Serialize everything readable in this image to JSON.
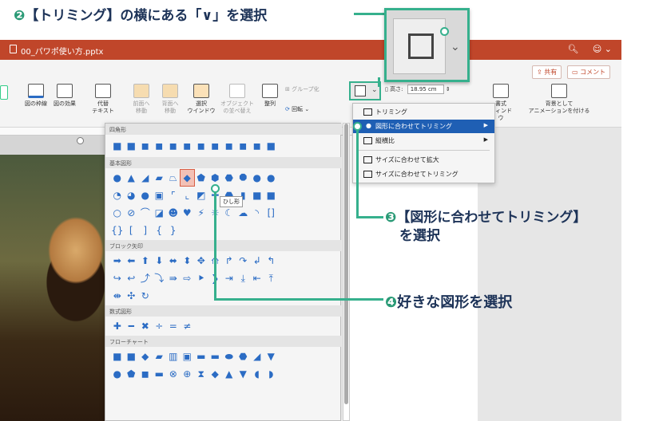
{
  "annotations": {
    "step2_num": "❷",
    "step2_text": "【トリミング】の横にある「∨」を選択",
    "step3_num": "❸",
    "step3_text_line1": "【図形に合わせてトリミング】",
    "step3_text_line2": "を選択",
    "step4_num": "❹",
    "step4_text": "好きな図形を選択"
  },
  "window": {
    "file_name": "00_パワポ使い方.pptx",
    "search_icon": "search-icon",
    "account_icon": "smiley-icon"
  },
  "ribbon": {
    "share_label": "共有",
    "comment_label": "コメント",
    "frame_label": "図の枠線",
    "effects_label": "図の効果",
    "alt_text_line1": "代替",
    "alt_text_line2": "テキスト",
    "bring_forward_line1": "前面へ",
    "bring_forward_line2": "移動",
    "send_backward_line1": "背面へ",
    "send_backward_line2": "移動",
    "selection_pane_line1": "選択",
    "selection_pane_line2": "ウインドウ",
    "reorder_line1": "オブジェクト",
    "reorder_line2": "の並べ替え",
    "align_label": "整列",
    "group_label": "グループ化",
    "rotate_label": "回転",
    "height_label": "高さ:",
    "height_value": "18.95 cm",
    "format_pane_line1": "書式",
    "format_pane_line2": "ウィンドウ",
    "background_anim_line1": "背景として",
    "background_anim_line2": "アニメーションを付ける"
  },
  "crop_menu": {
    "items": [
      {
        "label": "トリミング"
      },
      {
        "label": "図形に合わせてトリミング"
      },
      {
        "label": "縦横比"
      },
      {
        "label": "サイズに合わせて拡大"
      },
      {
        "label": "サイズに合わせてトリミング"
      }
    ]
  },
  "shapes_gallery": {
    "sections": [
      "四角形",
      "基本図形",
      "ブロック矢印",
      "数式図形",
      "フローチャート"
    ],
    "tooltip": "ひし形"
  },
  "colors": {
    "accent_green": "#36b08d",
    "title_bar": "#c0462a",
    "shape_blue": "#2b6cc4",
    "menu_highlight": "#1f5fb4",
    "callout_text": "#1d3358"
  }
}
